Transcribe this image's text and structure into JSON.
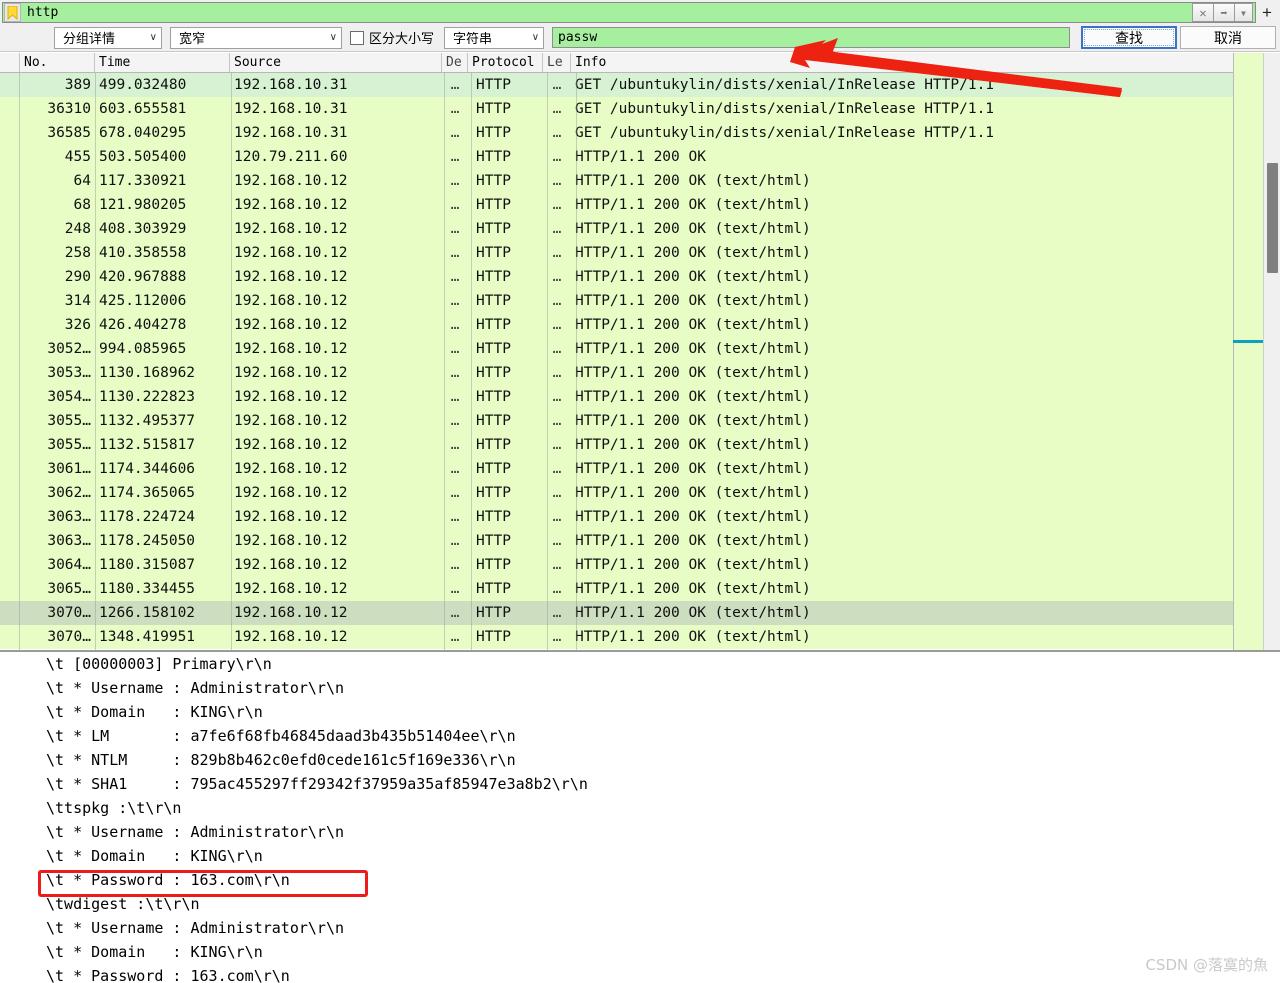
{
  "filter_bar": {
    "bookmark_icon": "bookmark-icon",
    "value": "http",
    "clear_label": "✕",
    "apply_label": "➡",
    "dropdown_label": "▾",
    "add_label": "+"
  },
  "find_bar": {
    "search_in": "分组详情",
    "display_mode": "宽窄",
    "case_sensitive_label": "区分大小写",
    "case_sensitive_checked": false,
    "value_type": "字符串",
    "search_value": "passw",
    "search_placeholder": "",
    "find_button": "查找",
    "cancel_button": "取消",
    "chevron": "∨"
  },
  "packet_list": {
    "columns": [
      "No.",
      "Time",
      "Source",
      "De",
      "Protocol",
      "Le",
      "Info"
    ],
    "rows": [
      {
        "no": "389",
        "time": "499.032480",
        "src": "192.168.10.31",
        "dst": "…",
        "proto": "HTTP",
        "len": "…",
        "info": "GET /ubuntukylin/dists/xenial/InRelease HTTP/1.1",
        "state": "first"
      },
      {
        "no": "36310",
        "time": "603.655581",
        "src": "192.168.10.31",
        "dst": "…",
        "proto": "HTTP",
        "len": "…",
        "info": "GET /ubuntukylin/dists/xenial/InRelease HTTP/1.1",
        "state": "normal"
      },
      {
        "no": "36585",
        "time": "678.040295",
        "src": "192.168.10.31",
        "dst": "…",
        "proto": "HTTP",
        "len": "…",
        "info": "GET /ubuntukylin/dists/xenial/InRelease HTTP/1.1",
        "state": "normal"
      },
      {
        "no": "455",
        "time": "503.505400",
        "src": "120.79.211.60",
        "dst": "…",
        "proto": "HTTP",
        "len": "…",
        "info": "HTTP/1.1 200 OK",
        "state": "normal"
      },
      {
        "no": "64",
        "time": "117.330921",
        "src": "192.168.10.12",
        "dst": "…",
        "proto": "HTTP",
        "len": "…",
        "info": "HTTP/1.1 200 OK  (text/html)",
        "state": "normal"
      },
      {
        "no": "68",
        "time": "121.980205",
        "src": "192.168.10.12",
        "dst": "…",
        "proto": "HTTP",
        "len": "…",
        "info": "HTTP/1.1 200 OK  (text/html)",
        "state": "normal"
      },
      {
        "no": "248",
        "time": "408.303929",
        "src": "192.168.10.12",
        "dst": "…",
        "proto": "HTTP",
        "len": "…",
        "info": "HTTP/1.1 200 OK  (text/html)",
        "state": "normal"
      },
      {
        "no": "258",
        "time": "410.358558",
        "src": "192.168.10.12",
        "dst": "…",
        "proto": "HTTP",
        "len": "…",
        "info": "HTTP/1.1 200 OK  (text/html)",
        "state": "normal"
      },
      {
        "no": "290",
        "time": "420.967888",
        "src": "192.168.10.12",
        "dst": "…",
        "proto": "HTTP",
        "len": "…",
        "info": "HTTP/1.1 200 OK  (text/html)",
        "state": "normal"
      },
      {
        "no": "314",
        "time": "425.112006",
        "src": "192.168.10.12",
        "dst": "…",
        "proto": "HTTP",
        "len": "…",
        "info": "HTTP/1.1 200 OK  (text/html)",
        "state": "normal"
      },
      {
        "no": "326",
        "time": "426.404278",
        "src": "192.168.10.12",
        "dst": "…",
        "proto": "HTTP",
        "len": "…",
        "info": "HTTP/1.1 200 OK  (text/html)",
        "state": "normal"
      },
      {
        "no": "3052…",
        "time": "994.085965",
        "src": "192.168.10.12",
        "dst": "…",
        "proto": "HTTP",
        "len": "…",
        "info": "HTTP/1.1 200 OK  (text/html)",
        "state": "normal"
      },
      {
        "no": "3053…",
        "time": "1130.168962",
        "src": "192.168.10.12",
        "dst": "…",
        "proto": "HTTP",
        "len": "…",
        "info": "HTTP/1.1 200 OK  (text/html)",
        "state": "normal"
      },
      {
        "no": "3054…",
        "time": "1130.222823",
        "src": "192.168.10.12",
        "dst": "…",
        "proto": "HTTP",
        "len": "…",
        "info": "HTTP/1.1 200 OK  (text/html)",
        "state": "normal"
      },
      {
        "no": "3055…",
        "time": "1132.495377",
        "src": "192.168.10.12",
        "dst": "…",
        "proto": "HTTP",
        "len": "…",
        "info": "HTTP/1.1 200 OK  (text/html)",
        "state": "normal"
      },
      {
        "no": "3055…",
        "time": "1132.515817",
        "src": "192.168.10.12",
        "dst": "…",
        "proto": "HTTP",
        "len": "…",
        "info": "HTTP/1.1 200 OK  (text/html)",
        "state": "normal"
      },
      {
        "no": "3061…",
        "time": "1174.344606",
        "src": "192.168.10.12",
        "dst": "…",
        "proto": "HTTP",
        "len": "…",
        "info": "HTTP/1.1 200 OK  (text/html)",
        "state": "normal"
      },
      {
        "no": "3062…",
        "time": "1174.365065",
        "src": "192.168.10.12",
        "dst": "…",
        "proto": "HTTP",
        "len": "…",
        "info": "HTTP/1.1 200 OK  (text/html)",
        "state": "normal"
      },
      {
        "no": "3063…",
        "time": "1178.224724",
        "src": "192.168.10.12",
        "dst": "…",
        "proto": "HTTP",
        "len": "…",
        "info": "HTTP/1.1 200 OK  (text/html)",
        "state": "normal"
      },
      {
        "no": "3063…",
        "time": "1178.245050",
        "src": "192.168.10.12",
        "dst": "…",
        "proto": "HTTP",
        "len": "…",
        "info": "HTTP/1.1 200 OK  (text/html)",
        "state": "normal"
      },
      {
        "no": "3064…",
        "time": "1180.315087",
        "src": "192.168.10.12",
        "dst": "…",
        "proto": "HTTP",
        "len": "…",
        "info": "HTTP/1.1 200 OK  (text/html)",
        "state": "normal"
      },
      {
        "no": "3065…",
        "time": "1180.334455",
        "src": "192.168.10.12",
        "dst": "…",
        "proto": "HTTP",
        "len": "…",
        "info": "HTTP/1.1 200 OK  (text/html)",
        "state": "normal"
      },
      {
        "no": "3070…",
        "time": "1266.158102",
        "src": "192.168.10.12",
        "dst": "…",
        "proto": "HTTP",
        "len": "…",
        "info": "HTTP/1.1 200 OK  (text/html)",
        "state": "selected"
      },
      {
        "no": "3070…",
        "time": "1348.419951",
        "src": "192.168.10.12",
        "dst": "…",
        "proto": "HTTP",
        "len": "…",
        "info": "HTTP/1.1 200 OK  (text/html)",
        "state": "normal"
      }
    ]
  },
  "detail_pane": {
    "lines": [
      "\\t [00000003] Primary\\r\\n",
      "\\t * Username : Administrator\\r\\n",
      "\\t * Domain   : KING\\r\\n",
      "\\t * LM       : a7fe6f68fb46845daad3b435b51404ee\\r\\n",
      "\\t * NTLM     : 829b8b462c0efd0cede161c5f169e336\\r\\n",
      "\\t * SHA1     : 795ac455297ff29342f37959a35af85947e3a8b2\\r\\n",
      "\\ttspkg :\\t\\r\\n",
      "\\t * Username : Administrator\\r\\n",
      "\\t * Domain   : KING\\r\\n",
      "\\t * Password : 163.com\\r\\n",
      "\\twdigest :\\t\\r\\n",
      "\\t * Username : Administrator\\r\\n",
      "\\t * Domain   : KING\\r\\n",
      "\\t * Password : 163.com\\r\\n"
    ],
    "highlight_line_index": 9
  },
  "annotations": {
    "arrow_color": "#ee2211",
    "highlight_box_color": "#ee1b1b"
  },
  "watermark": "CSDN @落寞的魚"
}
